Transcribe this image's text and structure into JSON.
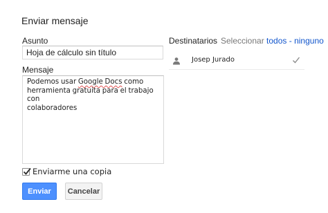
{
  "dialog": {
    "title": "Enviar mensaje",
    "subject": {
      "label": "Asunto",
      "value": "Hoja de cálculo sin título"
    },
    "message": {
      "label": "Mensaje",
      "segments": [
        "Podemos usar ",
        "Google Docs",
        " como\nherramienta gratuita para el trabajo con\ncolaboradores"
      ]
    },
    "send_copy": {
      "label": "Enviarme una copia",
      "checked": true
    },
    "buttons": {
      "send": "Enviar",
      "cancel": "Cancelar"
    },
    "recipients": {
      "title": "Destinatarios",
      "select_label": "Seleccionar",
      "select_all": "todos",
      "separator": "-",
      "select_none": "ninguno",
      "items": [
        {
          "name": "Josep Jurado",
          "checked": true,
          "icon": "person-icon"
        }
      ]
    }
  },
  "colors": {
    "primary_button": "#4d90fe",
    "link": "#1155cc",
    "checkmark": "#2a2a2a"
  }
}
